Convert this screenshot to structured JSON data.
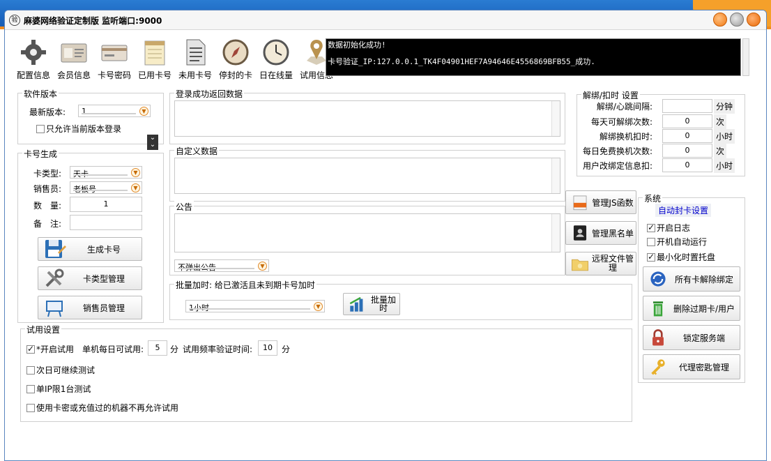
{
  "window": {
    "title": "麻婆网络验证定制版  监听端口:9000",
    "app_icon": "验"
  },
  "toolbar": [
    {
      "label": "配置信息",
      "icon": "gear-icon"
    },
    {
      "label": "会员信息",
      "icon": "id-card-icon"
    },
    {
      "label": "卡号密码",
      "icon": "card-icon"
    },
    {
      "label": "已用卡号",
      "icon": "notepad-icon"
    },
    {
      "label": "未用卡号",
      "icon": "document-icon"
    },
    {
      "label": "停封的卡",
      "icon": "compass-icon"
    },
    {
      "label": "日在线量",
      "icon": "clock-icon"
    },
    {
      "label": "试用信息",
      "icon": "map-pin-icon"
    }
  ],
  "log": {
    "line1": "数据初始化成功!",
    "line2": "卡号验证_IP:127.0.0.1_TK4F04901HEF7A94646E4556869BFB55_成功."
  },
  "software_version": {
    "legend": "软件版本",
    "latest_label": "最新版本:",
    "latest_value": "1",
    "only_current_label": "只允许当前版本登录",
    "only_current_checked": false
  },
  "card_gen": {
    "legend": "卡号生成",
    "type_label": "卡类型:",
    "type_value": "天卡",
    "seller_label": "销售员:",
    "seller_value": "老板号",
    "qty_label": "数　量:",
    "qty_value": "1",
    "note_label": "备　注:",
    "note_value": "",
    "btn_generate": "生成卡号",
    "btn_type_mgmt": "卡类型管理",
    "btn_seller_mgmt": "销售员管理"
  },
  "login_return": {
    "legend": "登录成功返回数据"
  },
  "custom_data": {
    "legend": "自定义数据"
  },
  "notice": {
    "legend": "公告",
    "popup_value": "不弹出公告"
  },
  "batch": {
    "legend": "批量加时:  给已激活且未到期卡号加时",
    "time_value": "1小时",
    "btn_label": "批量加时"
  },
  "unbind": {
    "legend": "解绑/扣时 设置",
    "rows": [
      {
        "label": "解绑/心跳间隔:",
        "value": "",
        "unit": "分钟"
      },
      {
        "label": "每天可解绑次数:",
        "value": "0",
        "unit": "次"
      },
      {
        "label": "解绑换机扣时:",
        "value": "0",
        "unit": "小时"
      },
      {
        "label": "每日免费换机次数:",
        "value": "0",
        "unit": "次"
      },
      {
        "label": "用户改绑定信息扣:",
        "value": "0",
        "unit": "小时"
      }
    ]
  },
  "mid_buttons": {
    "js": "管理JS函数",
    "blacklist": "管理黑名单",
    "remote_file": "远程文件管理"
  },
  "system": {
    "legend": "系统",
    "auto_ban": "自动封卡设置",
    "enable_log": "开启日志",
    "enable_log_checked": true,
    "autostart": "开机自动运行",
    "autostart_checked": false,
    "tray": "最小化时置托盘",
    "tray_checked": true,
    "btn_unbind_all": "所有卡解除绑定",
    "btn_delete_expired": "删除过期卡/用户",
    "btn_lock": "锁定服务端",
    "btn_agent": "代理密匙管理"
  },
  "trial": {
    "legend": "试用设置",
    "enable": "*开启试用",
    "enable_checked": true,
    "daily_label": "单机每日可试用:",
    "daily_value": "5",
    "unit_min1": "分",
    "freq_label": "试用频率验证时间:",
    "freq_value": "10",
    "unit_min2": "分",
    "next_day": "次日可继续测试",
    "one_ip": "单IP限1台测试",
    "no_retry": "使用卡密或充值过的机器不再允许试用"
  },
  "colors": {
    "titlebar": "#1d67c1",
    "accent_orange": "#f28c1e",
    "log_bg": "#000000",
    "link_blue": "#0000cc"
  }
}
